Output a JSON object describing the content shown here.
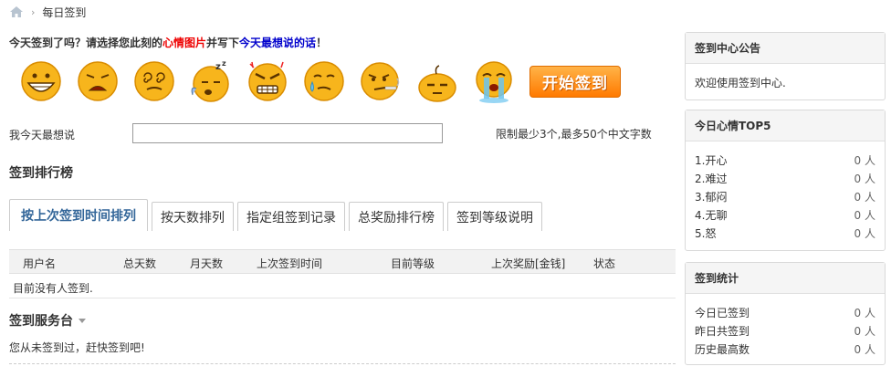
{
  "breadcrumb": {
    "current": "每日签到"
  },
  "intro": {
    "part1": "今天签到了吗？请选择您此刻的",
    "highlight1": "心情图片",
    "part2": "并写下",
    "highlight2": "今天最想说的话",
    "part3": "！"
  },
  "moods": [
    "开心",
    "难过",
    "郁闷",
    "无聊",
    "怒",
    "擦汗",
    "奋斗",
    "慵懒",
    "衰"
  ],
  "start_button": "开始签到",
  "say": {
    "label": "我今天最想说",
    "value": "",
    "hint": "限制最少3个,最多50个中文字数"
  },
  "rank": {
    "title": "签到排行榜",
    "tabs": [
      "按上次签到时间排列",
      "按天数排列",
      "指定组签到记录",
      "总奖励排行榜",
      "签到等级说明"
    ],
    "columns": [
      "用户名",
      "总天数",
      "月天数",
      "上次签到时间",
      "目前等级",
      "上次奖励[金钱]",
      "状态"
    ],
    "empty": "目前没有人签到."
  },
  "service": {
    "title": "签到服务台",
    "text": "您从未签到过，赶快签到吧!"
  },
  "notice": {
    "title": "签到中心公告",
    "text": "欢迎使用签到中心."
  },
  "top5": {
    "title": "今日心情TOP5",
    "items": [
      {
        "label": "1.开心",
        "count": "0 人"
      },
      {
        "label": "2.难过",
        "count": "0 人"
      },
      {
        "label": "3.郁闷",
        "count": "0 人"
      },
      {
        "label": "4.无聊",
        "count": "0 人"
      },
      {
        "label": "5.怒",
        "count": "0 人"
      }
    ]
  },
  "stats": {
    "title": "签到统计",
    "items": [
      {
        "label": "今日已签到",
        "count": "0 人"
      },
      {
        "label": "昨日共签到",
        "count": "0 人"
      },
      {
        "label": "历史最高数",
        "count": "0 人"
      }
    ]
  },
  "colors": {
    "accent": "#336699",
    "highlight_red": "#ee0000",
    "highlight_blue": "#0000cc",
    "button": "#ff8c00",
    "face": "#f5a623"
  }
}
